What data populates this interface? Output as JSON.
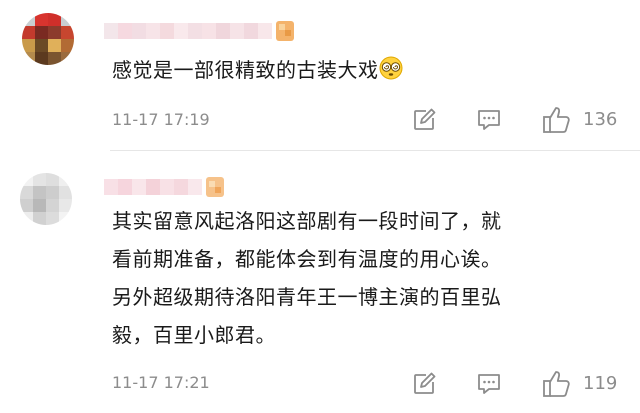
{
  "comments": [
    {
      "text": "感觉是一部很精致的古装大戏",
      "emoji_icon": "dizzy-eyes-emoji-icon",
      "time": "11-17 17:19",
      "like_count": "136"
    },
    {
      "lines": [
        "其实留意风起洛阳这部剧有一段时间了，就",
        "看前期准备，都能体会到有温度的用心诶。",
        "另外超级期待洛阳青年王一博主演的百里弘",
        "毅，百里小郎君。"
      ],
      "time": "11-17 17:21",
      "like_count": "119"
    }
  ],
  "icons": {
    "edit": "edit-icon",
    "reply": "reply-icon",
    "like": "thumbs-up-icon"
  },
  "colors": {
    "text": "#1a1a1a",
    "meta": "#8c8c8c",
    "badge": "#f4b36b"
  }
}
